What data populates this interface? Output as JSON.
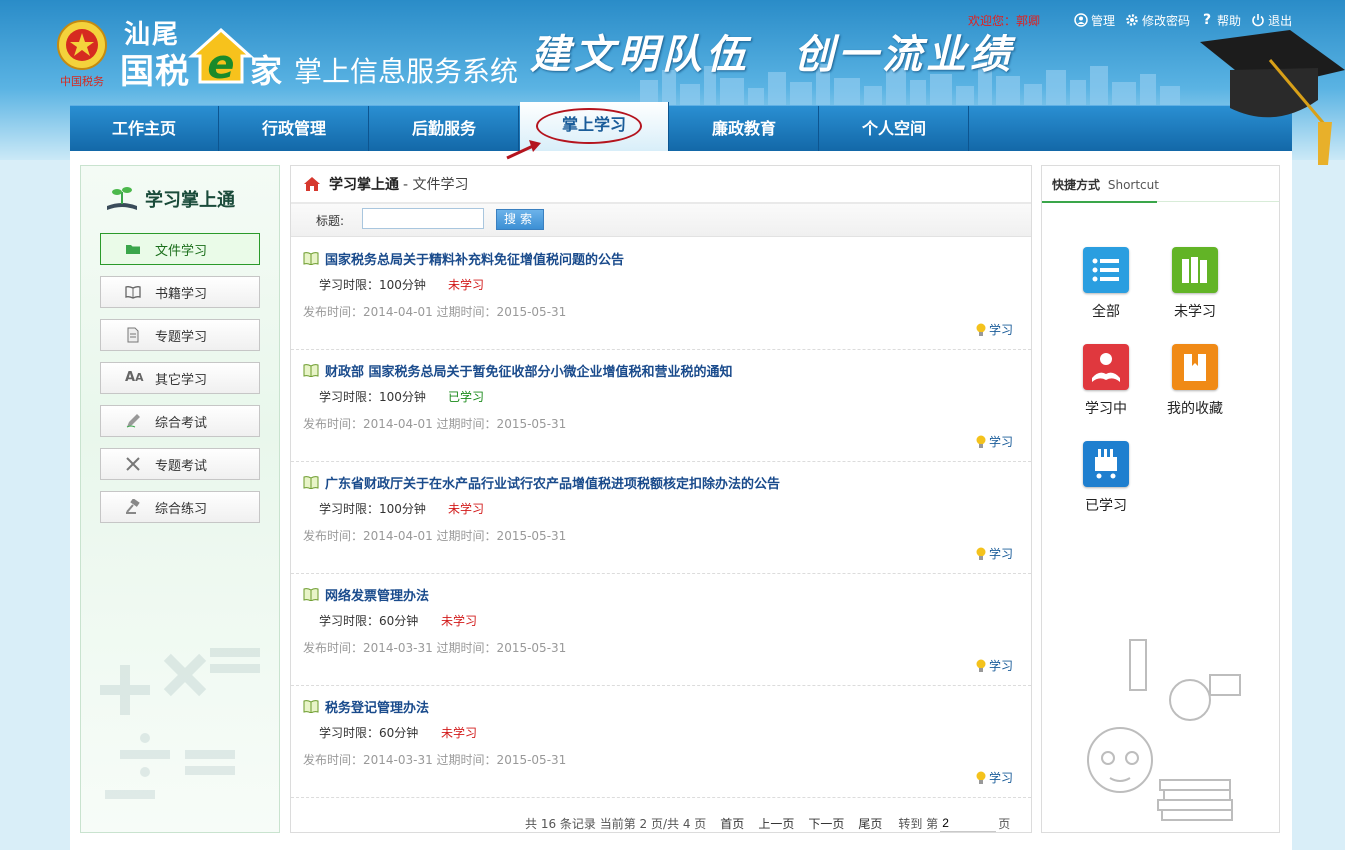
{
  "header": {
    "logo_city": "汕尾",
    "logo_brand": "国税",
    "logo_e": "e",
    "logo_jia": "家",
    "system_title": "掌上信息服务系统",
    "slogan": "建文明队伍　创一流业绩",
    "emblem_text": "中国税务",
    "welcome": "欢迎您：郭卿",
    "links": {
      "manage": "管理",
      "change_password": "修改密码",
      "help": "帮助",
      "logout": "退出"
    }
  },
  "nav": {
    "items": [
      "工作主页",
      "行政管理",
      "后勤服务",
      "掌上学习",
      "廉政教育",
      "个人空间"
    ],
    "active_index": 3
  },
  "sidebar": {
    "title": "学习掌上通",
    "items": [
      {
        "label": "文件学习",
        "icon": "folder-icon",
        "active": true
      },
      {
        "label": "书籍学习",
        "icon": "book-icon",
        "active": false
      },
      {
        "label": "专题学习",
        "icon": "document-icon",
        "active": false
      },
      {
        "label": "其它学习",
        "icon": "font-icon",
        "active": false
      },
      {
        "label": "综合考试",
        "icon": "pencil-icon",
        "active": false
      },
      {
        "label": "专题考试",
        "icon": "tools-icon",
        "active": false
      },
      {
        "label": "综合练习",
        "icon": "gavel-icon",
        "active": false
      }
    ]
  },
  "main": {
    "breadcrumb_root": "学习掌上通",
    "breadcrumb_current": " - 文件学习",
    "search": {
      "label": "标题:",
      "value": "",
      "button": "搜索"
    },
    "documents": [
      {
        "title": "国家税务总局关于精料补充料免征增值税问题的公告",
        "limit": "学习时限：100分钟",
        "status": "未学习",
        "status_color": "#d21a1a",
        "dates": "发布时间：2014-04-01 过期时间：2015-05-31",
        "action": "学习"
      },
      {
        "title": "财政部 国家税务总局关于暂免征收部分小微企业增值税和营业税的通知",
        "limit": "学习时限：100分钟",
        "status": "已学习",
        "status_color": "#1a8a1a",
        "dates": "发布时间：2014-04-01 过期时间：2015-05-31",
        "action": "学习"
      },
      {
        "title": "广东省财政厅关于在水产品行业试行农产品增值税进项税额核定扣除办法的公告",
        "limit": "学习时限：100分钟",
        "status": "未学习",
        "status_color": "#d21a1a",
        "dates": "发布时间：2014-04-01 过期时间：2015-05-31",
        "action": "学习"
      },
      {
        "title": "网络发票管理办法",
        "limit": "学习时限：60分钟",
        "status": "未学习",
        "status_color": "#d21a1a",
        "dates": "发布时间：2014-03-31 过期时间：2015-05-31",
        "action": "学习"
      },
      {
        "title": "税务登记管理办法",
        "limit": "学习时限：60分钟",
        "status": "未学习",
        "status_color": "#d21a1a",
        "dates": "发布时间：2014-03-31 过期时间：2015-05-31",
        "action": "学习"
      }
    ],
    "pager": {
      "summary": "共 16 条记录 当前第 2 页/共 4 页",
      "first": "首页",
      "prev": "上一页",
      "next": "下一页",
      "last": "尾页",
      "goto_prefix": "转到 第",
      "goto_value": "2",
      "goto_suffix": "页"
    }
  },
  "shortcut": {
    "title_cn": "快捷方式",
    "title_en": "Shortcut",
    "items": [
      {
        "label": "全部",
        "icon": "list-icon",
        "color": "#2a9ee0"
      },
      {
        "label": "未学习",
        "icon": "books-icon",
        "color": "#62b426"
      },
      {
        "label": "学习中",
        "icon": "reader-icon",
        "color": "#e0383e"
      },
      {
        "label": "我的收藏",
        "icon": "bookmark-icon",
        "color": "#f08a16"
      },
      {
        "label": "已学习",
        "icon": "cart-icon",
        "color": "#1f7fcf"
      }
    ]
  }
}
